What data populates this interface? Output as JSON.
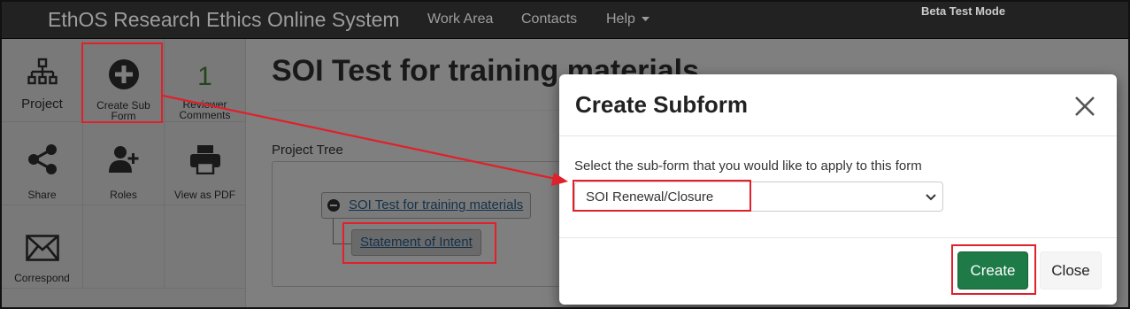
{
  "navbar": {
    "brand": "EthOS Research Ethics Online System",
    "links": [
      "Work Area",
      "Contacts",
      "Help"
    ],
    "beta": "Beta Test Mode"
  },
  "sidebar": {
    "project": "Project",
    "create_sub_form": "Create Sub Form",
    "reviewer_count": "1",
    "reviewer_comments": "Reviewer Comments",
    "share": "Share",
    "roles": "Roles",
    "view_as_pdf": "View as PDF",
    "correspond": "Correspond"
  },
  "main": {
    "title": "SOI Test for training materials",
    "tree_label": "Project Tree",
    "tree": {
      "root": "SOI Test for training materials",
      "child": "Statement of Intent"
    }
  },
  "modal": {
    "title": "Create Subform",
    "select_label": "Select the sub-form that you would like to apply to this form",
    "selected_option": "SOI Renewal/Closure",
    "create_label": "Create",
    "close_label": "Close"
  },
  "colors": {
    "navbar": "#222222",
    "create_button": "#1e7a46",
    "annotation": "#e0202a",
    "link": "#2a6496"
  },
  "icons": {
    "project": "sitemap-icon",
    "create_sub_form": "plus-circle-icon",
    "share": "share-icon",
    "roles": "add-user-icon",
    "view_as_pdf": "printer-icon",
    "correspond": "envelope-icon",
    "close": "close-icon",
    "select": "chevron-down-icon",
    "help": "caret-down-icon"
  }
}
